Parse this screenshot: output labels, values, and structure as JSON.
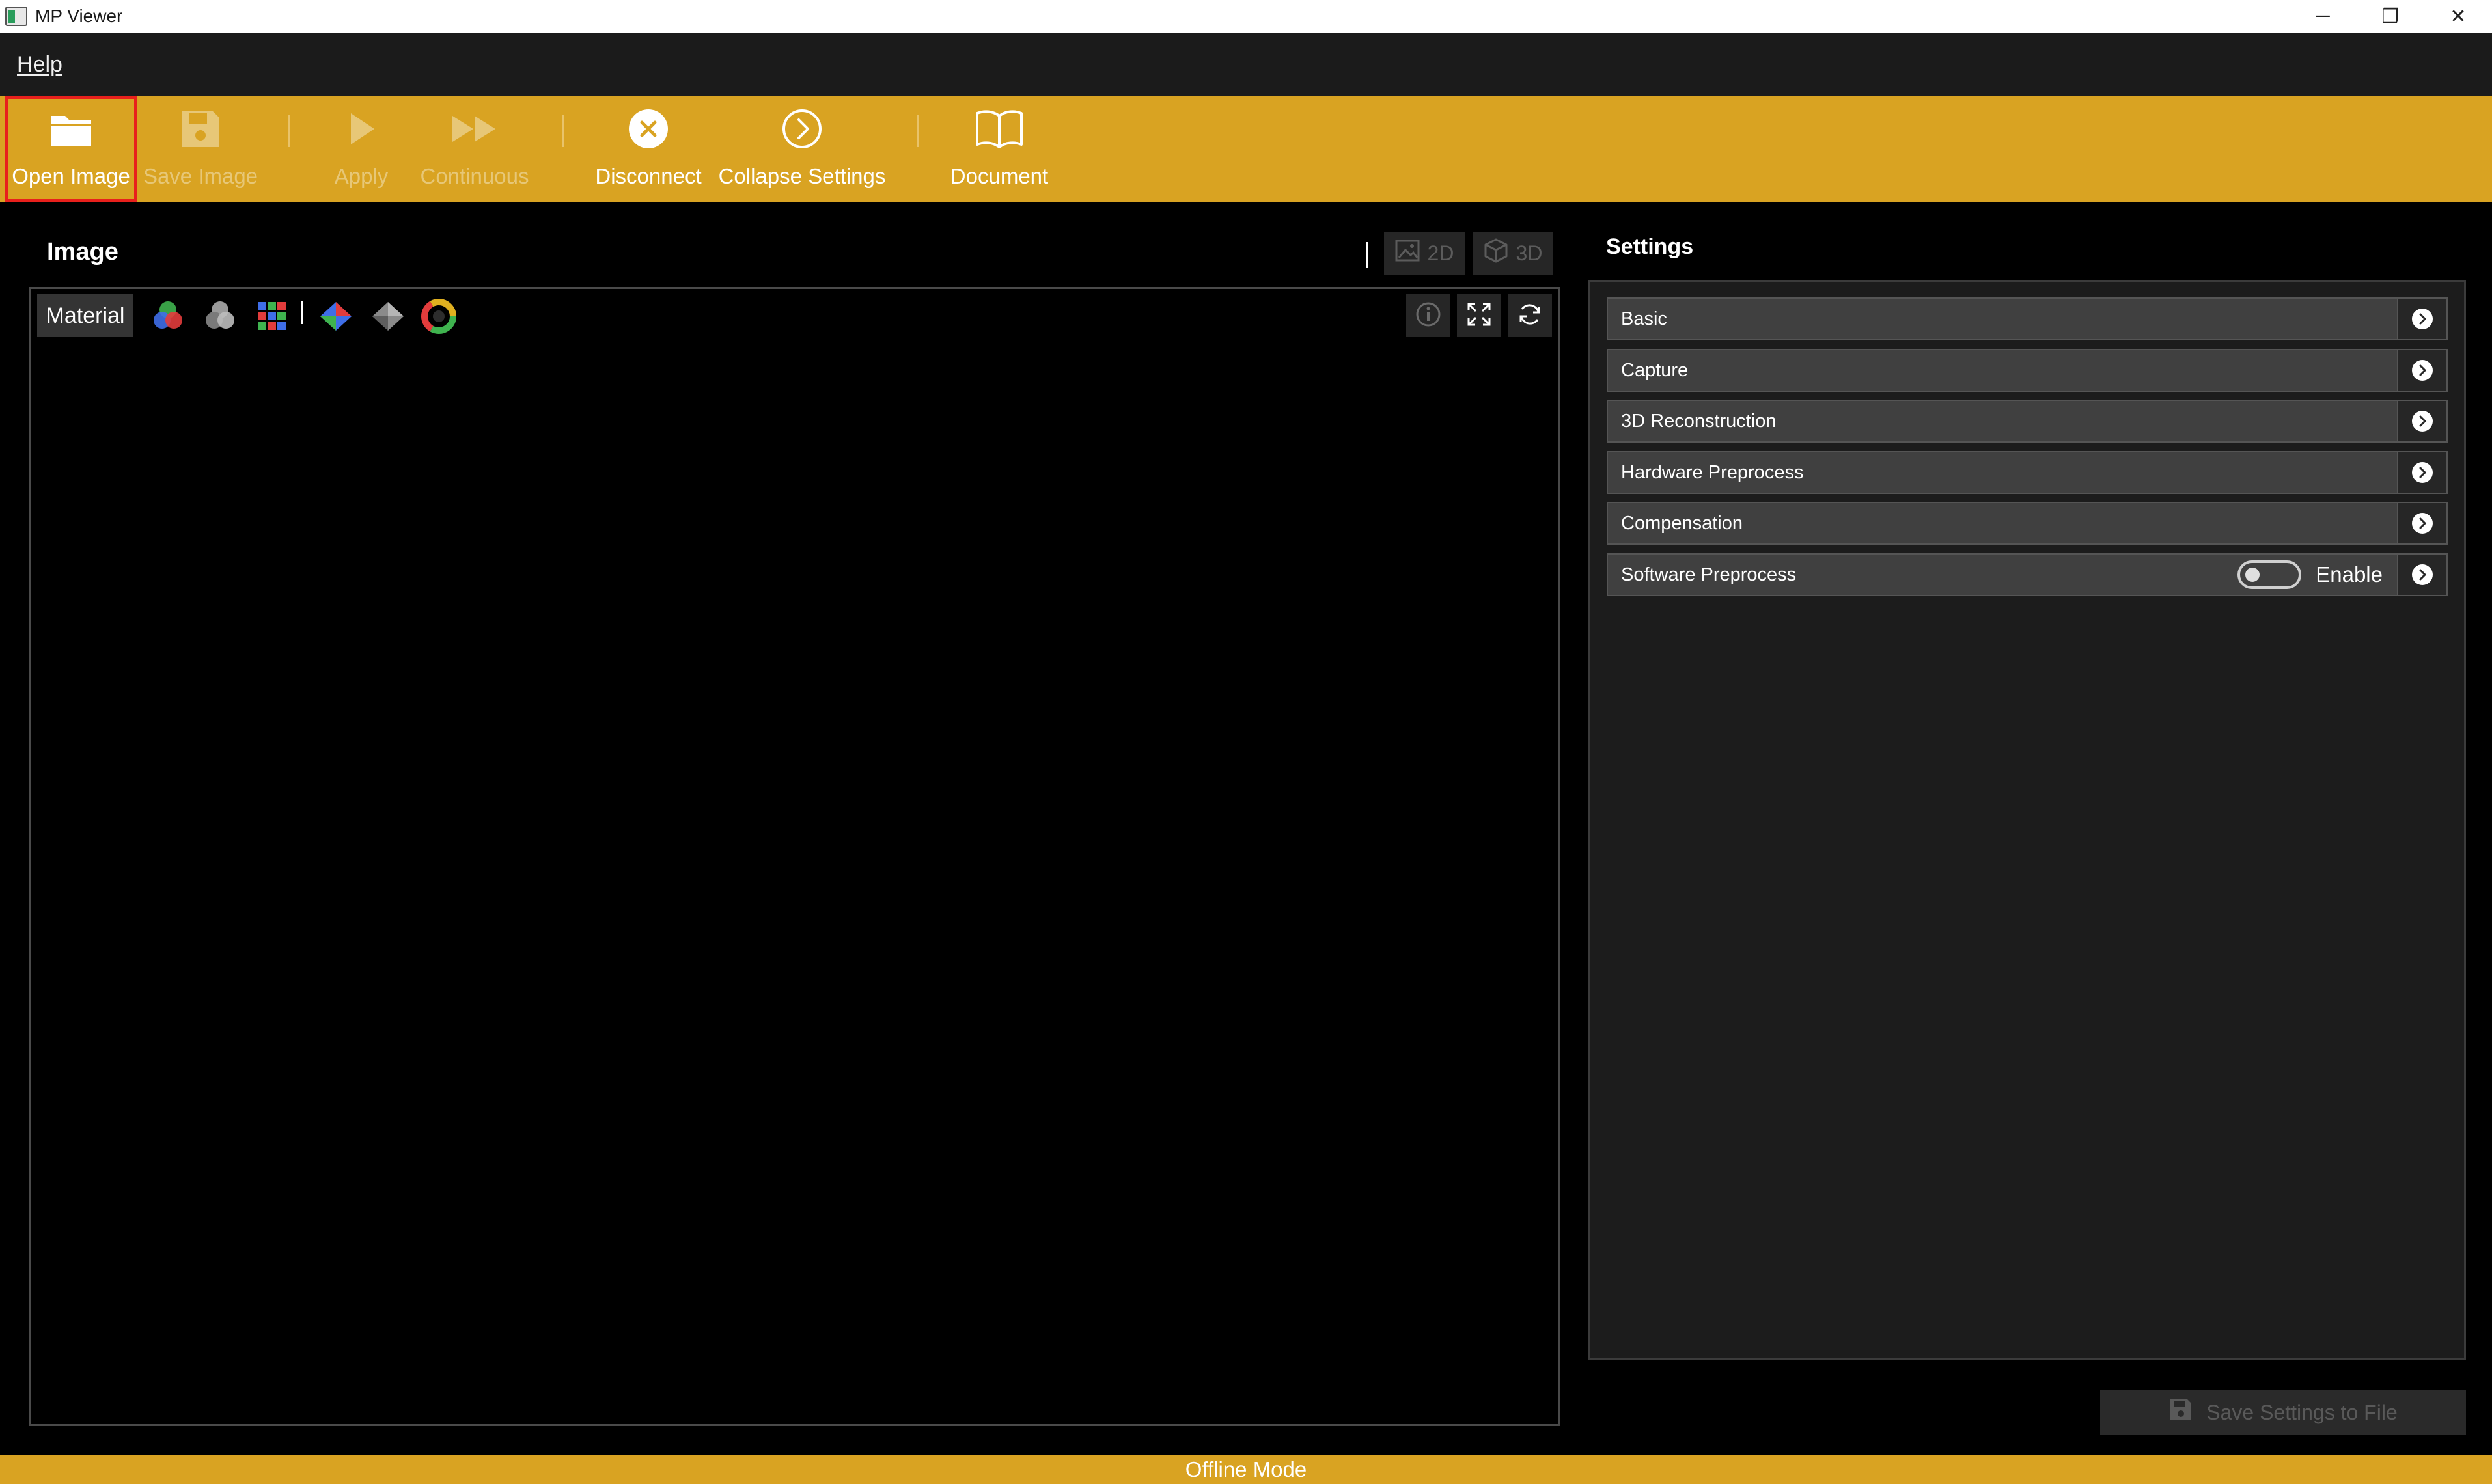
{
  "window": {
    "title": "MP Viewer",
    "controls": {
      "minimize": "─",
      "restore": "❐",
      "close": "✕"
    }
  },
  "menu": {
    "items": [
      "Help"
    ]
  },
  "toolbar": {
    "background": "#d9a322",
    "buttons": [
      {
        "label": "Open Image",
        "icon": "folder-open-icon",
        "enabled": true,
        "selected": true
      },
      {
        "label": "Save Image",
        "icon": "save-icon",
        "enabled": false
      },
      {
        "label": "Apply",
        "icon": "play-icon",
        "enabled": false
      },
      {
        "label": "Continuous",
        "icon": "fast-forward-icon",
        "enabled": false
      },
      {
        "label": "Disconnect",
        "icon": "close-circle-icon",
        "enabled": true
      },
      {
        "label": "Collapse Settings",
        "icon": "chevron-right-circle-icon",
        "enabled": true
      },
      {
        "label": "Document",
        "icon": "book-open-icon",
        "enabled": true
      }
    ]
  },
  "image_panel": {
    "title": "Image",
    "view_buttons": [
      {
        "label": "2D",
        "icon": "image-icon",
        "enabled": false
      },
      {
        "label": "3D",
        "icon": "cube-icon",
        "enabled": false
      }
    ],
    "material_label": "Material",
    "material_icons": [
      "rgb-circles-icon",
      "gray-circles-icon",
      "color-grid-icon",
      "color-diamond-icon",
      "gray-diamond-icon",
      "color-ring-icon"
    ],
    "frame_buttons": [
      "info-icon",
      "fit-view-icon",
      "refresh-icon"
    ]
  },
  "settings": {
    "title": "Settings",
    "sections": [
      {
        "label": "Basic"
      },
      {
        "label": "Capture"
      },
      {
        "label": "3D Reconstruction"
      },
      {
        "label": "Hardware Preprocess"
      },
      {
        "label": "Compensation"
      },
      {
        "label": "Software Preprocess",
        "toggle_label": "Enable",
        "toggle_on": false
      }
    ],
    "save_button": "Save Settings to File"
  },
  "status": {
    "text": "Offline Mode"
  }
}
